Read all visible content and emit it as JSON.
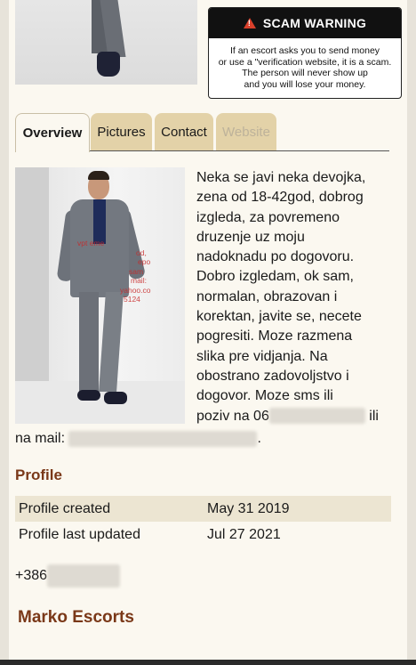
{
  "scam_warning": {
    "title": "SCAM WARNING",
    "lines": [
      "If an escort asks you to send money",
      "or use a \"verification website, it is a scam.",
      "The person will never show up",
      "and you will lose your money."
    ]
  },
  "tabs": [
    {
      "label": "Overview",
      "state": "active"
    },
    {
      "label": "Pictures",
      "state": "normal"
    },
    {
      "label": "Contact",
      "state": "normal"
    },
    {
      "label": "Website",
      "state": "disabled"
    }
  ],
  "photo_watermark": [
    "vpt eme",
    "od,",
    "epo",
    "sam",
    "mail:",
    "yahoo.co",
    "5124"
  ],
  "description": {
    "lines": [
      "Neka se javi neka devojka,",
      "zena od 18-42god, dobrog",
      "izgleda, za povremeno",
      "druzenje uz moju",
      "nadoknadu po dogovoru.",
      "Dobro izgledam, ok sam,",
      "normalan, obrazovan i",
      "korektan, javite se, necete",
      "pogresiti. Moze razmena",
      "slika pre vidjanja. Na",
      "obostrano zadovoljstvo i",
      "dogovor. Moze sms ili"
    ],
    "last_line_start": "poziv na 06",
    "last_line_end": "ili",
    "mail_label": "na mail:",
    "mail_end": "."
  },
  "profile": {
    "title": "Profile",
    "rows": [
      {
        "label": "Profile created",
        "value": "May 31 2019"
      },
      {
        "label": "Profile last updated",
        "value": "Jul 27 2021"
      }
    ]
  },
  "phone_prefix": "+386",
  "company_name": "Marko Escorts",
  "colors": {
    "accent": "#7a3818",
    "tab_bg": "#e3d2a8",
    "warning_red": "#d9402b"
  }
}
